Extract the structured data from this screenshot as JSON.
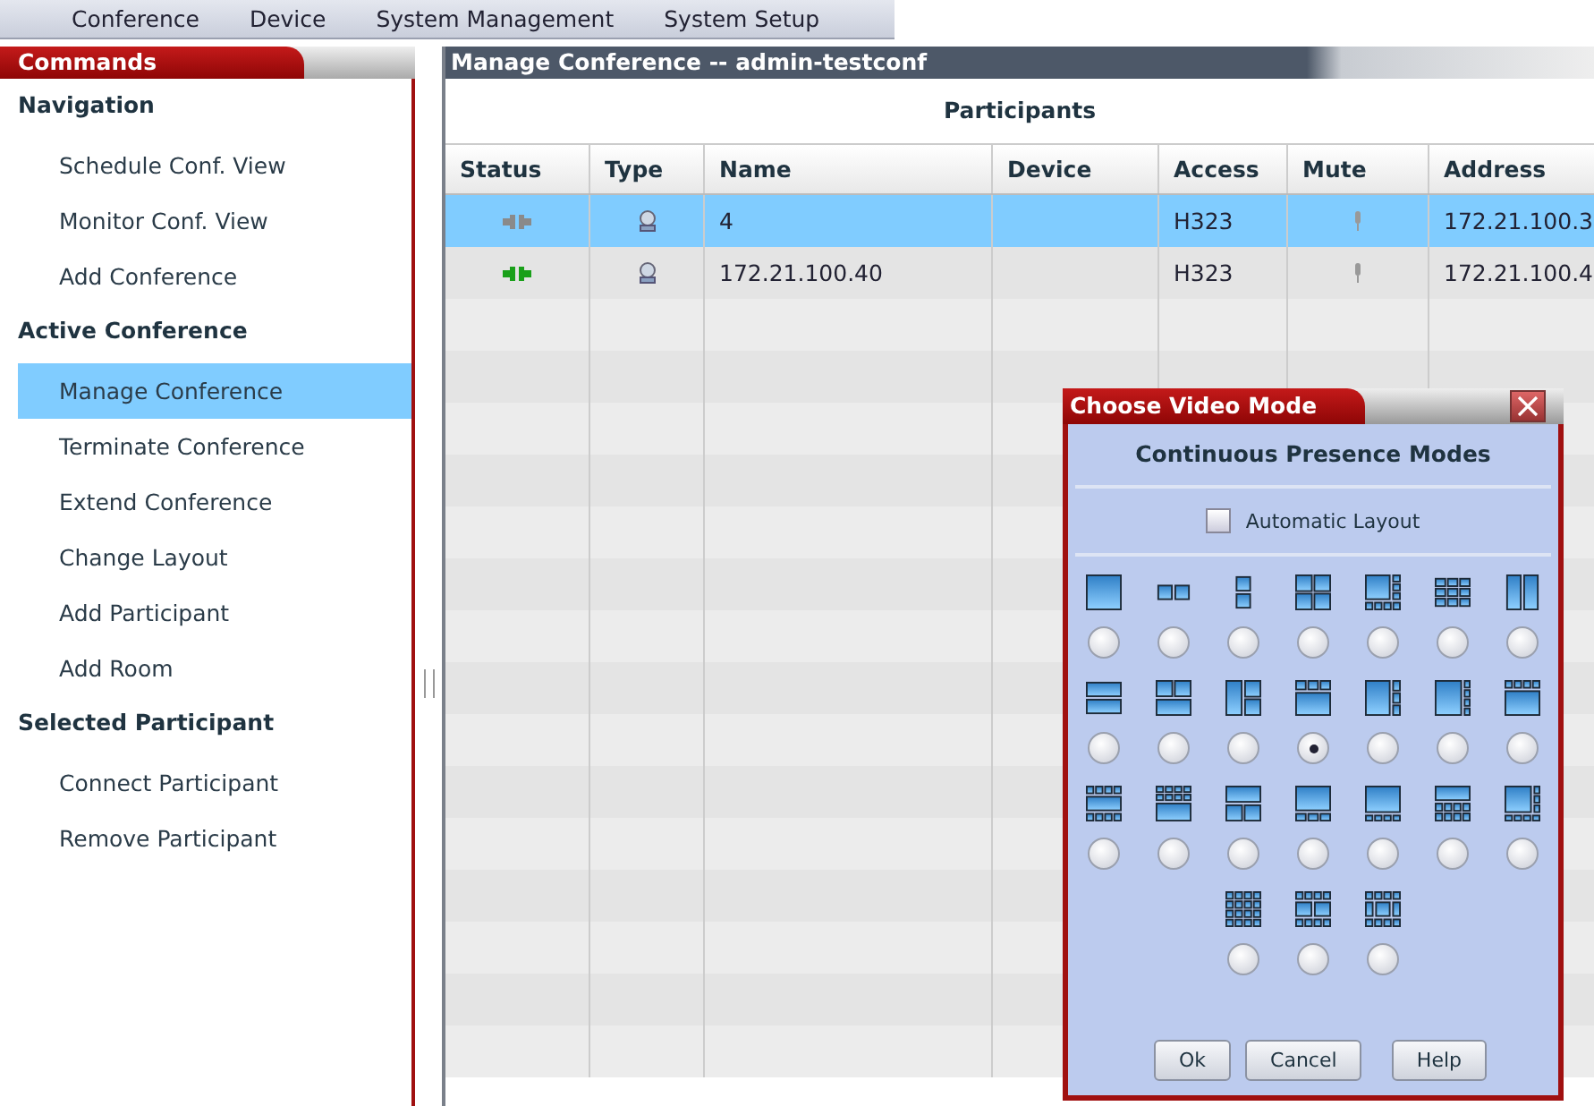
{
  "menu": [
    {
      "label": "Conference"
    },
    {
      "label": "Device"
    },
    {
      "label": "System Management"
    },
    {
      "label": "System Setup"
    }
  ],
  "commands": {
    "title": "Commands",
    "sections": [
      {
        "heading": "Navigation",
        "items": [
          {
            "label": "Schedule Conf. View",
            "selected": false
          },
          {
            "label": "Monitor Conf. View",
            "selected": false
          },
          {
            "label": "Add Conference",
            "selected": false
          }
        ]
      },
      {
        "heading": "Active Conference",
        "items": [
          {
            "label": "Manage Conference",
            "selected": true
          },
          {
            "label": "Terminate Conference",
            "selected": false
          },
          {
            "label": "Extend Conference",
            "selected": false
          },
          {
            "label": "Change Layout",
            "selected": false
          },
          {
            "label": "Add Participant",
            "selected": false
          },
          {
            "label": "Add Room",
            "selected": false
          }
        ]
      },
      {
        "heading": "Selected Participant",
        "items": [
          {
            "label": "Connect Participant",
            "selected": false
          },
          {
            "label": "Remove Participant",
            "selected": false
          }
        ]
      }
    ]
  },
  "main": {
    "title": "Manage Conference -- admin-testconf",
    "table_title": "Participants",
    "columns": [
      "Status",
      "Type",
      "Name",
      "Device",
      "Access",
      "Mute",
      "Address"
    ],
    "rows": [
      {
        "connected": false,
        "name": "4",
        "device": "",
        "access": "H323",
        "address": "172.21.100.3",
        "selected": true
      },
      {
        "connected": true,
        "name": "172.21.100.40",
        "device": "",
        "access": "H323",
        "address": "172.21.100.4",
        "selected": false
      }
    ]
  },
  "dialog": {
    "title": "Choose Video Mode",
    "heading": "Continuous Presence Modes",
    "automatic_layout": {
      "label": "Automatic Layout",
      "checked": false
    },
    "layout_rows": [
      [
        {
          "selected": false
        },
        {
          "selected": false
        },
        {
          "selected": false
        },
        {
          "selected": false
        },
        {
          "selected": false
        },
        {
          "selected": false
        },
        {
          "selected": false
        }
      ],
      [
        {
          "selected": false
        },
        {
          "selected": false
        },
        {
          "selected": false
        },
        {
          "selected": true
        },
        {
          "selected": false
        },
        {
          "selected": false
        },
        {
          "selected": false
        }
      ],
      [
        {
          "selected": false
        },
        {
          "selected": false
        },
        {
          "selected": false
        },
        {
          "selected": false
        },
        {
          "selected": false
        },
        {
          "selected": false
        },
        {
          "selected": false
        }
      ],
      [
        {
          "selected": false
        },
        {
          "selected": false
        },
        {
          "selected": false
        }
      ]
    ],
    "buttons": [
      {
        "label": "Ok"
      },
      {
        "label": "Cancel"
      },
      {
        "label": "Help"
      }
    ]
  }
}
